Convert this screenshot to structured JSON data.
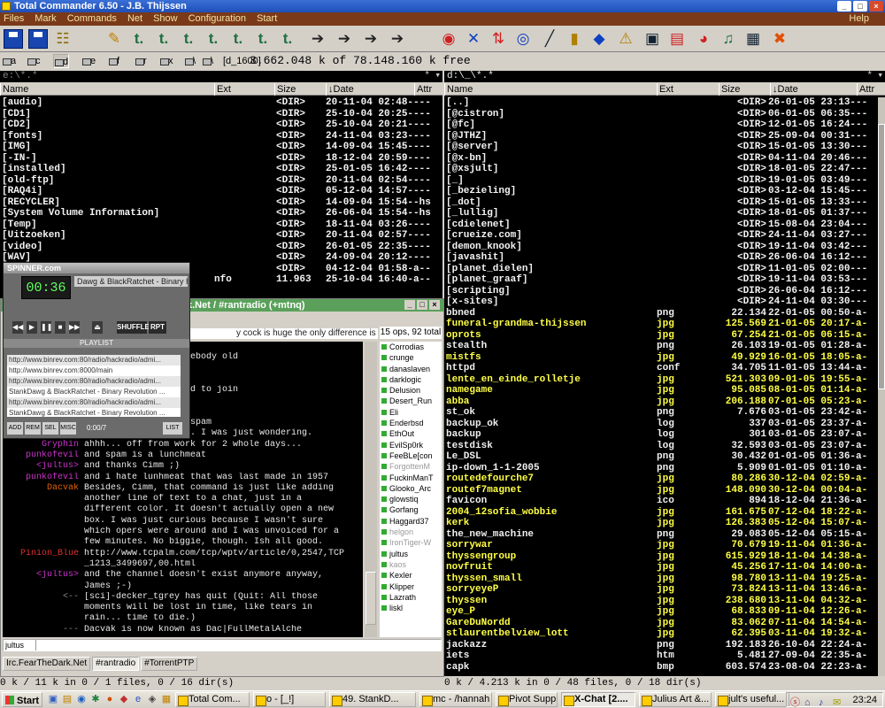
{
  "window": {
    "title": "Total Commander 6.50 - J.B. Thijssen",
    "help": "Help"
  },
  "menu": [
    "Files",
    "Mark",
    "Commands",
    "Net",
    "Show",
    "Configuration",
    "Start"
  ],
  "drivebar": {
    "drives": [
      "a",
      "c",
      "d",
      "e",
      "f",
      "r",
      "x",
      "\\",
      "\\"
    ],
    "current_dir_label": "[d_1600]",
    "free_info": "3.662.048 k of 78.148.160 k free"
  },
  "left_panel": {
    "path": "e:\\*.*",
    "columns": {
      "name": "Name",
      "ext": "Ext",
      "size": "Size",
      "date": "↓Date",
      "attr": "Attr"
    },
    "rows": [
      {
        "name": "[audio]",
        "ext": "",
        "size": "<DIR>",
        "date": "20-11-04 02:48----"
      },
      {
        "name": "[CD1]",
        "ext": "",
        "size": "<DIR>",
        "date": "25-10-04 20:25----"
      },
      {
        "name": "[CD2]",
        "ext": "",
        "size": "<DIR>",
        "date": "25-10-04 20:21----"
      },
      {
        "name": "[fonts]",
        "ext": "",
        "size": "<DIR>",
        "date": "24-11-04 03:23----"
      },
      {
        "name": "[IMG]",
        "ext": "",
        "size": "<DIR>",
        "date": "14-09-04 15:45----"
      },
      {
        "name": "[-IN-]",
        "ext": "",
        "size": "<DIR>",
        "date": "18-12-04 20:59----"
      },
      {
        "name": "[installed]",
        "ext": "",
        "size": "<DIR>",
        "date": "25-01-05 16:42----"
      },
      {
        "name": "[old-ftp]",
        "ext": "",
        "size": "<DIR>",
        "date": "20-11-04 02:54----"
      },
      {
        "name": "[RAQ4i]",
        "ext": "",
        "size": "<DIR>",
        "date": "05-12-04 14:57----"
      },
      {
        "name": "[RECYCLER]",
        "ext": "",
        "size": "<DIR>",
        "date": "14-09-04 15:54--hs"
      },
      {
        "name": "[System Volume Information]",
        "ext": "",
        "size": "<DIR>",
        "date": "26-06-04 15:54--hs"
      },
      {
        "name": "[Temp]",
        "ext": "",
        "size": "<DIR>",
        "date": "18-11-04 03:26----"
      },
      {
        "name": "[Uitzoeken]",
        "ext": "",
        "size": "<DIR>",
        "date": "20-11-04 02:57----"
      },
      {
        "name": "[video]",
        "ext": "",
        "size": "<DIR>",
        "date": "26-01-05 22:35----"
      },
      {
        "name": "[WAV]",
        "ext": "",
        "size": "<DIR>",
        "date": "24-09-04 20:12----"
      },
      {
        "name": "",
        "ext": "",
        "size": "<DIR>",
        "date": "04-12-04 01:58-a--"
      },
      {
        "name": "",
        "ext": "nfo",
        "size": "11.963",
        "date": "25-10-04 16:40-a--"
      }
    ],
    "status": "0 k / 11 k in 0 / 1 files, 0 / 16 dir(s)"
  },
  "right_panel": {
    "path": "d:\\_\\*.*",
    "columns": {
      "name": "Name",
      "ext": "Ext",
      "size": "Size",
      "date": "↓Date",
      "attr": "Attr"
    },
    "rows": [
      {
        "name": "[..]",
        "ext": "",
        "size": "<DIR>",
        "date": "26-01-05 23:13---",
        "t": "dir"
      },
      {
        "name": "[@cistron]",
        "ext": "",
        "size": "<DIR>",
        "date": "06-01-05 06:35---",
        "t": "dir"
      },
      {
        "name": "[@fc]",
        "ext": "",
        "size": "<DIR>",
        "date": "12-01-05 16:24---",
        "t": "dir"
      },
      {
        "name": "[@JTHZ]",
        "ext": "",
        "size": "<DIR>",
        "date": "25-09-04 00:31---",
        "t": "dir"
      },
      {
        "name": "[@server]",
        "ext": "",
        "size": "<DIR>",
        "date": "15-01-05 13:30---",
        "t": "dir"
      },
      {
        "name": "[@x-bn]",
        "ext": "",
        "size": "<DIR>",
        "date": "04-11-04 20:46---",
        "t": "dir"
      },
      {
        "name": "[@xsjult]",
        "ext": "",
        "size": "<DIR>",
        "date": "18-01-05 22:47---",
        "t": "dir"
      },
      {
        "name": "[_]",
        "ext": "",
        "size": "<DIR>",
        "date": "19-01-05 03:49---",
        "t": "dir"
      },
      {
        "name": "[_bezieling]",
        "ext": "",
        "size": "<DIR>",
        "date": "03-12-04 15:45---",
        "t": "dir"
      },
      {
        "name": "[_dot]",
        "ext": "",
        "size": "<DIR>",
        "date": "15-01-05 13:33---",
        "t": "dir"
      },
      {
        "name": "[_lullig]",
        "ext": "",
        "size": "<DIR>",
        "date": "18-01-05 01:37---",
        "t": "dir"
      },
      {
        "name": "[cdielenet]",
        "ext": "",
        "size": "<DIR>",
        "date": "15-08-04 23:04---",
        "t": "dir"
      },
      {
        "name": "[crueize.com]",
        "ext": "",
        "size": "<DIR>",
        "date": "24-11-04 03:27---",
        "t": "dir"
      },
      {
        "name": "[demon_knook]",
        "ext": "",
        "size": "<DIR>",
        "date": "19-11-04 03:42---",
        "t": "dir"
      },
      {
        "name": "[javashit]",
        "ext": "",
        "size": "<DIR>",
        "date": "26-06-04 16:12---",
        "t": "dir"
      },
      {
        "name": "[planet_dielen]",
        "ext": "",
        "size": "<DIR>",
        "date": "11-01-05 02:00---",
        "t": "dir"
      },
      {
        "name": "[planet_graaf]",
        "ext": "",
        "size": "<DIR>",
        "date": "19-11-04 03:53---",
        "t": "dir"
      },
      {
        "name": "[scripting]",
        "ext": "",
        "size": "<DIR>",
        "date": "26-06-04 16:12---",
        "t": "dir"
      },
      {
        "name": "[x-sites]",
        "ext": "",
        "size": "<DIR>",
        "date": "24-11-04 03:30---",
        "t": "dir"
      },
      {
        "name": "bbned",
        "ext": "png",
        "size": "22.134",
        "date": "22-01-05 00:50-a-",
        "t": "other"
      },
      {
        "name": "funeral-grandma-thijssen",
        "ext": "jpg",
        "size": "125.569",
        "date": "21-01-05 20:17-a-",
        "t": "jpg"
      },
      {
        "name": "oprots",
        "ext": "jpg",
        "size": "67.254",
        "date": "21-01-05 06:15-a-",
        "t": "jpg"
      },
      {
        "name": "stealth",
        "ext": "png",
        "size": "26.103",
        "date": "19-01-05 01:28-a-",
        "t": "other"
      },
      {
        "name": "mistfs",
        "ext": "jpg",
        "size": "49.929",
        "date": "16-01-05 18:05-a-",
        "t": "jpg"
      },
      {
        "name": "httpd",
        "ext": "conf",
        "size": "34.705",
        "date": "11-01-05 13:44-a-",
        "t": "other"
      },
      {
        "name": "lente_en_einde_rolletje",
        "ext": "jpg",
        "size": "521.303",
        "date": "09-01-05 19:55-a-",
        "t": "jpg"
      },
      {
        "name": "namegame",
        "ext": "jpg",
        "size": "95.085",
        "date": "08-01-05 01:14-a-",
        "t": "jpg"
      },
      {
        "name": "abba",
        "ext": "jpg",
        "size": "206.188",
        "date": "07-01-05 05:23-a-",
        "t": "jpg"
      },
      {
        "name": "st_ok",
        "ext": "png",
        "size": "7.676",
        "date": "03-01-05 23:42-a-",
        "t": "other"
      },
      {
        "name": "backup_ok",
        "ext": "log",
        "size": "337",
        "date": "03-01-05 23:37-a-",
        "t": "other"
      },
      {
        "name": "backup",
        "ext": "log",
        "size": "301",
        "date": "03-01-05 23:07-a-",
        "t": "other"
      },
      {
        "name": "testdisk",
        "ext": "log",
        "size": "32.593",
        "date": "03-01-05 23:07-a-",
        "t": "other"
      },
      {
        "name": "Le_DSL",
        "ext": "png",
        "size": "30.432",
        "date": "01-01-05 01:36-a-",
        "t": "other"
      },
      {
        "name": "ip-down_1-1-2005",
        "ext": "png",
        "size": "5.909",
        "date": "01-01-05 01:10-a-",
        "t": "other"
      },
      {
        "name": "routedefourche7",
        "ext": "jpg",
        "size": "80.286",
        "date": "30-12-04 02:59-a-",
        "t": "jpg"
      },
      {
        "name": "routef7magnet",
        "ext": "jpg",
        "size": "148.090",
        "date": "30-12-04 00:04-a-",
        "t": "jpg"
      },
      {
        "name": "favicon",
        "ext": "ico",
        "size": "894",
        "date": "18-12-04 21:36-a-",
        "t": "other"
      },
      {
        "name": "2004_12sofia_wobbie",
        "ext": "jpg",
        "size": "161.675",
        "date": "07-12-04 18:22-a-",
        "t": "jpg"
      },
      {
        "name": "kerk",
        "ext": "jpg",
        "size": "126.383",
        "date": "05-12-04 15:07-a-",
        "t": "jpg"
      },
      {
        "name": "the_new_machine",
        "ext": "png",
        "size": "29.083",
        "date": "05-12-04 05:15-a-",
        "t": "other"
      },
      {
        "name": "sorrywar",
        "ext": "jpg",
        "size": "70.679",
        "date": "19-11-04 01:36-a-",
        "t": "jpg"
      },
      {
        "name": "thyssengroup",
        "ext": "jpg",
        "size": "615.929",
        "date": "18-11-04 14:38-a-",
        "t": "jpg"
      },
      {
        "name": "novfruit",
        "ext": "jpg",
        "size": "45.256",
        "date": "17-11-04 14:00-a-",
        "t": "jpg"
      },
      {
        "name": "thyssen_small",
        "ext": "jpg",
        "size": "98.780",
        "date": "13-11-04 19:25-a-",
        "t": "jpg"
      },
      {
        "name": "sorryeyeP",
        "ext": "jpg",
        "size": "73.824",
        "date": "13-11-04 13:46-a-",
        "t": "jpg"
      },
      {
        "name": "thyssen",
        "ext": "jpg",
        "size": "238.680",
        "date": "13-11-04 04:32-a-",
        "t": "jpg"
      },
      {
        "name": "eye_P",
        "ext": "jpg",
        "size": "68.833",
        "date": "09-11-04 12:26-a-",
        "t": "jpg"
      },
      {
        "name": "GareDuNordd",
        "ext": "jpg",
        "size": "83.062",
        "date": "07-11-04 14:54-a-",
        "t": "jpg"
      },
      {
        "name": "stlaurentbelview_lott",
        "ext": "jpg",
        "size": "62.395",
        "date": "03-11-04 19:32-a-",
        "t": "jpg"
      },
      {
        "name": "jackazz",
        "ext": "png",
        "size": "192.183",
        "date": "26-10-04 22:24-a-",
        "t": "other"
      },
      {
        "name": "iets",
        "ext": "htm",
        "size": "5.481",
        "date": "27-09-04 22:35-a-",
        "t": "other"
      },
      {
        "name": "capk",
        "ext": "bmp",
        "size": "603.574",
        "date": "23-08-04 22:23-a-",
        "t": "other"
      }
    ],
    "status": "0 k / 4.213 k in 0 / 48 files, 0 / 18 dir(s)"
  },
  "xchat": {
    "title": "k.Net / #rantradio (+mtnq)",
    "topic": "y cock is huge the only difference is i'm telling the truth",
    "opcount": "15 ops, 92 total",
    "lines": [
      {
        "nick": "",
        "text": "why...",
        "c": "sys"
      },
      {
        "nick": "",
        "text": "ed im gonna stab somebody old",
        "c": "sys"
      },
      {
        "nick": "",
        "text": "",
        "c": "sys"
      },
      {
        "nick": "",
        "text": "imm",
        "c": "sys"
      },
      {
        "nick": "",
        "text": "advertising, I wanted to join",
        "c": "sys"
      },
      {
        "nick": "",
        "text": "ten in the wrong box",
        "c": "sys"
      },
      {
        "nick": "",
        "text": "",
        "c": "sys"
      },
      {
        "nick": "",
        "text": "ryone can result in spam",
        "c": "sys"
      },
      {
        "nick": "Dacvak",
        "text": "Nevermind then, dude. I was just wondering.",
        "c": "orange"
      },
      {
        "nick": "Gryphin",
        "text": "ahhh... off from work for 2 whole days...",
        "c": ""
      },
      {
        "nick": "punkofevil",
        "text": "and spam is a lunchmeat",
        "c": ""
      },
      {
        "nick": "<jultus>",
        "text": "and thanks Cimm ;)",
        "c": ""
      },
      {
        "nick": "punkofevil",
        "text": "and i hate lunhmeat that was last made in 1957",
        "c": ""
      },
      {
        "nick": "Dacvak",
        "text": "Besides, Cimm, that command is just like adding",
        "c": "orange"
      },
      {
        "nick": "",
        "text": "another line of text to a chat, just in a",
        "c": ""
      },
      {
        "nick": "",
        "text": "different color. It doesn't actually open a new",
        "c": ""
      },
      {
        "nick": "",
        "text": "box. I was just curious because I wasn't sure",
        "c": ""
      },
      {
        "nick": "",
        "text": "which opers were around and I was unvoiced for a",
        "c": ""
      },
      {
        "nick": "",
        "text": "few minutes. No biggie, though. Ish all good.",
        "c": ""
      },
      {
        "nick": "Pinion_Blue",
        "text": "http://www.tcpalm.com/tcp/wptv/article/0,2547,TCP",
        "c": "red"
      },
      {
        "nick": "",
        "text": "_1213_3499697,00.html",
        "c": ""
      },
      {
        "nick": "<jultus>",
        "text": "and the channel doesn't exist anymore anyway,",
        "c": ""
      },
      {
        "nick": "",
        "text": "James ;-)",
        "c": ""
      },
      {
        "nick": "<--",
        "text": "[sci]-decker_tgrey has quit (Quit: All those",
        "c": "sys"
      },
      {
        "nick": "",
        "text": "moments will be lost in time, like tears in",
        "c": ""
      },
      {
        "nick": "",
        "text": "rain... time to die.)",
        "c": ""
      },
      {
        "nick": "---",
        "text": "Dacvak is now known as Dac|FullMetalAlche",
        "c": "sys"
      }
    ],
    "users": [
      "Corrodias",
      "crunge",
      "danaslaven",
      "darklogic",
      "Delusion",
      "Desert_Run",
      "Eli",
      "Enderbsd",
      "EthOut",
      "EvilSp0rk",
      "FeeBLe[con",
      "ForgottenM",
      "FuckinManT",
      "Glooko_Arc",
      "glowstiq",
      "Gorfang",
      "Haggard37",
      "helgon",
      "IronTiger-W",
      "jultus",
      "kaos",
      "Kexler",
      "Klipper",
      "Lazrath",
      "liskl"
    ],
    "away_users": [
      "ForgottenM",
      "helgon",
      "IronTiger-W",
      "kaos"
    ],
    "input_nick": "jultus",
    "tabs": [
      "Irc.FearTheDark.Net",
      "#rantradio",
      "#TorrentPTP"
    ]
  },
  "spinner": {
    "title": "SPINNER.com",
    "time": "00:36",
    "song": "Dawg & BlackRatchet - Binary Rev",
    "shuffle": "SHUFFLE",
    "repeat": "RPT",
    "playlist_label": "PLAYLIST",
    "playlist": [
      "http://www.binrev.com:80/radio/hackradio/admi...",
      "http://www.binrev.com:8000/main",
      "http://www.binrev.com:80/radio/hackradio/admi...",
      "StankDawg & BlackRatchet - Binary Revolution ...",
      "http://www.binrev.com:80/radio/hackradio/admi...",
      "StankDawg & BlackRatchet - Binary Revolution ..."
    ],
    "pl_buttons": [
      "ADD",
      "REM",
      "SEL",
      "MISC",
      "LIST"
    ],
    "pl_time": "0:00/7"
  },
  "taskbar": {
    "start": "Start",
    "tasks": [
      "Total Com...",
      "o - [_!]",
      "49. StankD...",
      "mc - /hannah",
      "Pivot Supp...",
      "X-Chat [2....",
      "Julius Art &...",
      "jult's useful..."
    ],
    "active_task": 5,
    "clock": "23:24"
  }
}
